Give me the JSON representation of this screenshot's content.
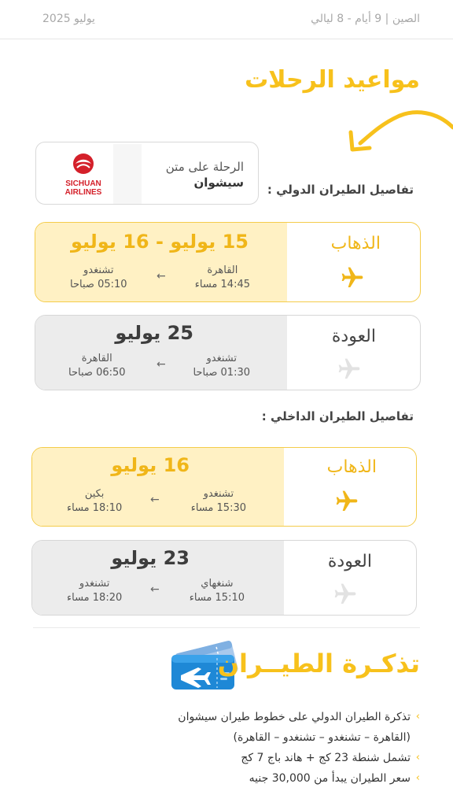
{
  "header": {
    "trip_info": "الصين | 9 أيام - 8 ليالي",
    "period": "يوليو 2025"
  },
  "title": "مواعيد الرحلات",
  "airline": {
    "line1": "الرحلة على متن",
    "line2": "سيشوان",
    "logo_text_1": "SICHUAN",
    "logo_text_2": "AIRLINES",
    "logo_color": "#d4202a"
  },
  "international_label": "تفاصيل الطيران الدولي :",
  "domestic_label": "تفاصيل الطيران الداخلي :",
  "international": {
    "outbound": {
      "direction": "الذهاب",
      "date": "15 يوليو - 16 يوليو",
      "from_city": "القاهرة",
      "from_time": "14:45 مساء",
      "to_city": "تشنغدو",
      "to_time": "05:10 صباحا"
    },
    "return": {
      "direction": "العودة",
      "date": "25 يوليو",
      "from_city": "تشنغدو",
      "from_time": "01:30 صباحا",
      "to_city": "القاهرة",
      "to_time": "06:50 صباحا"
    }
  },
  "domestic": {
    "outbound": {
      "direction": "الذهاب",
      "date": "16 يوليو",
      "from_city": "تشنغدو",
      "from_time": "15:30 مساء",
      "to_city": "بكين",
      "to_time": "18:10 مساء"
    },
    "return": {
      "direction": "العودة",
      "date": "23 يوليو",
      "from_city": "شنغهاي",
      "from_time": "15:10 مساء",
      "to_city": "تشنغدو",
      "to_time": "18:20 مساء"
    }
  },
  "ticket": {
    "title": "تذكـرة الطيــران",
    "bullets": [
      "تذكرة الطيران الدولي على خطوط طيران سيشوان",
      "(القاهرة – تشنغدو – تشنغدو – القاهرة)",
      "تشمل شنطة 23 كج + هاند باج 7 كج",
      "سعر الطيران يبدأ من 30,000 جنيه"
    ]
  },
  "colors": {
    "accent": "#f7c11c",
    "outbound_panel": "#fff1c4",
    "return_panel": "#ececec"
  }
}
